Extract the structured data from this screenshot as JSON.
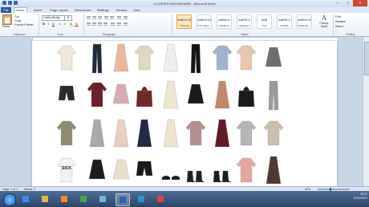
{
  "window": {
    "title": "CLOTHES MOODBOARD - Microsoft Word",
    "controls": [
      "–",
      "□",
      "×"
    ]
  },
  "tabs": [
    "File",
    "Home",
    "Insert",
    "Page Layout",
    "References",
    "Mailings",
    "Review",
    "View"
  ],
  "ribbon": {
    "clipboard": {
      "paste": "Paste",
      "cut": "Cut",
      "copy": "Copy",
      "format_painter": "Format Painter",
      "label": "Clipboard"
    },
    "font": {
      "name": "Calibri (Body)",
      "size": "11",
      "label": "Font",
      "buttons": [
        "B",
        "I",
        "U",
        "x",
        "x",
        "A",
        "A"
      ]
    },
    "paragraph": {
      "label": "Paragraph"
    },
    "styles": {
      "label": "Styles",
      "items": [
        {
          "sample": "AaBbCcDc",
          "name": "¶ Normal",
          "selected": true
        },
        {
          "sample": "AaBbCcDc",
          "name": "¶ No Spaci...",
          "selected": false
        },
        {
          "sample": "AaBbCc",
          "name": "Heading 1",
          "selected": false
        },
        {
          "sample": "AaBbCc",
          "name": "Heading 2",
          "selected": false
        },
        {
          "sample": "AaB",
          "name": "Title",
          "selected": false
        },
        {
          "sample": "AaBbCc",
          "name": "Subtitle",
          "selected": false
        },
        {
          "sample": "AaBbCcDc",
          "name": "Subtle Em...",
          "selected": false
        }
      ],
      "change_styles": "Change Styles"
    },
    "editing": {
      "label": "Editing",
      "find": "Find",
      "replace": "Replace",
      "select": "Select"
    }
  },
  "moodboard": {
    "rows": [
      [
        {
          "name": "cream-knit-sweater",
          "color": "#efe7dc"
        },
        {
          "name": "dark-skinny-jeans",
          "color": "#1f2a3b"
        },
        {
          "name": "peach-dress",
          "color": "#e8b79c"
        },
        {
          "name": "beige-sweater",
          "color": "#e2d6c2"
        },
        {
          "name": "white-tank-top",
          "color": "#eeeeea"
        },
        {
          "name": "black-leggings",
          "color": "#151515"
        },
        {
          "name": "blue-sweater",
          "color": "#9fb4cc"
        },
        {
          "name": "peach-lace-top",
          "color": "#e8c7b1"
        },
        {
          "name": "grey-maxi-skirt",
          "color": "#6e6e70"
        }
      ],
      [
        {
          "name": "black-shorts",
          "color": "#2b2b2b"
        },
        {
          "name": "burgundy-check-shirt",
          "color": "#6d1f2b"
        },
        {
          "name": "pink-skater-skirt",
          "color": "#d8aab3"
        },
        {
          "name": "burgundy-handbag",
          "color": "#6e2a2a"
        },
        {
          "name": "cream-dress",
          "color": "#efe6d2"
        },
        {
          "name": "black-aztec-skirt",
          "color": "#1a1a1a"
        },
        {
          "name": "tan-pinafore-dress",
          "color": "#c08a6a"
        },
        {
          "name": "black-handbag",
          "color": "#1c1c1c"
        },
        {
          "name": "grey-jeans",
          "color": "#9a9a9c"
        }
      ],
      [
        {
          "name": "khaki-tshirt",
          "color": "#8f8a73"
        },
        {
          "name": "grey-cami-top",
          "color": "#a9a9ab"
        },
        {
          "name": "floral-cami",
          "color": "#e7cfc4"
        },
        {
          "name": "navy-cami",
          "color": "#232945"
        },
        {
          "name": "cream-cami",
          "color": "#ede3d0"
        },
        {
          "name": "check-shirt",
          "color": "#b38f8f"
        },
        {
          "name": "burgundy-vest",
          "color": "#5e1c26"
        },
        {
          "name": "grey-tshirt",
          "color": "#b5b5b5"
        },
        {
          "name": "taupe-top",
          "color": "#cbbdb0"
        }
      ],
      [
        {
          "name": "sick-slogan-tee",
          "color": "#f2f2f2",
          "text": "SICK"
        },
        {
          "name": "black-skater-skirt",
          "color": "#1d1d1d"
        },
        {
          "name": "cream-skirt",
          "color": "#e8dfcc"
        },
        {
          "name": "black-shorts-2",
          "color": "#191919"
        },
        {
          "name": "black-ballet-flats",
          "color": "#1b1b1b"
        },
        {
          "name": "black-lace-boots",
          "color": "#202020"
        },
        {
          "name": "black-ankle-boots",
          "color": "#1e1e1e"
        },
        {
          "name": "pink-lace-top",
          "color": "#e2a8a0"
        },
        {
          "name": "brown-bodycon-dress",
          "color": "#4f3a33"
        }
      ]
    ]
  },
  "status": {
    "page": "Page: 1 of 1",
    "words": "Words: 0",
    "zoom": "80%"
  },
  "taskbar": {
    "time": "15:37",
    "date": "11/01/2013",
    "apps": [
      {
        "name": "ie-icon",
        "color": "#3a8ee6"
      },
      {
        "name": "explorer-icon",
        "color": "#e4b64a"
      },
      {
        "name": "media-player-icon",
        "color": "#f08a24"
      },
      {
        "name": "chrome-icon",
        "color": "#4aa04a"
      },
      {
        "name": "itunes-icon",
        "color": "#7ab0e0"
      },
      {
        "name": "word-icon",
        "color": "#2b5fb4",
        "active": true
      },
      {
        "name": "photoshop-icon",
        "color": "#2f8fc8"
      },
      {
        "name": "chrome-icon-2",
        "color": "#d9453a"
      }
    ]
  }
}
